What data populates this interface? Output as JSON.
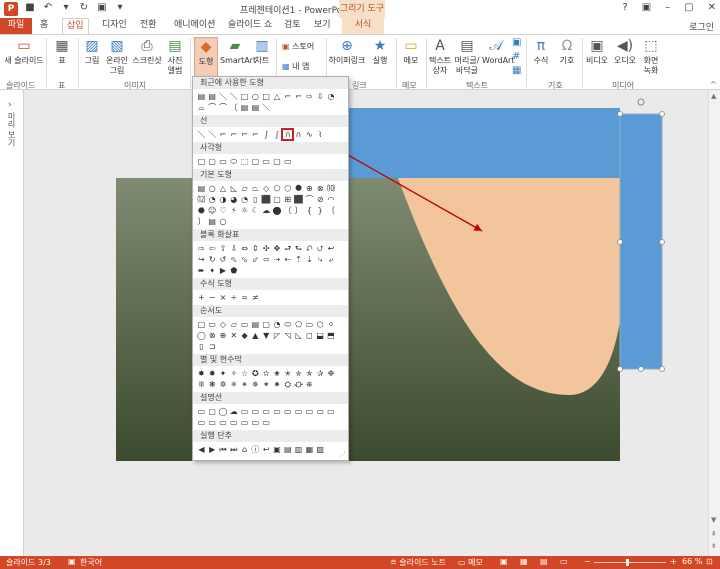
{
  "titlebar": {
    "app_logo": "P",
    "qat_icons": [
      "save-icon",
      "undo-icon",
      "undo-dropdown-icon",
      "redo-icon",
      "present-icon",
      "customize-icon"
    ],
    "qat_glyphs": [
      "■",
      "↶",
      "▾",
      "↻",
      "▣",
      "▾"
    ],
    "doc_title": "프레젠테이션1 - PowerPoint",
    "context_title": "그리기 도구",
    "controls": [
      "?",
      "▣",
      "–",
      "▢",
      "✕"
    ]
  },
  "tabs": {
    "file": "파일",
    "items": [
      "홈",
      "삽입",
      "디자인",
      "전환",
      "애니메이션",
      "슬라이드 쇼",
      "검토",
      "보기"
    ],
    "context_tab": "서식",
    "login": "로그인"
  },
  "ribbon": {
    "new_slide": "새 슬라이드",
    "table": "표",
    "picture": "그림",
    "online_picture": "온라인 그림",
    "screenshot": "스크린샷",
    "photo_album": "사진 앨범",
    "shapes": "도형",
    "smartart": "SmartArt",
    "chart": "차트",
    "store": "스토어",
    "my_apps": "내 앱",
    "hyperlink": "하이퍼링크",
    "action": "실행",
    "comment": "메모",
    "textbox": "텍스트 상자",
    "header_footer": "머리글/바닥글",
    "wordart": "WordArt",
    "equation": "수식",
    "symbol": "기호",
    "video": "비디오",
    "audio": "오디오",
    "screen_recording": "화면 녹화",
    "groups": [
      "슬라이드",
      "표",
      "이미지",
      "링크",
      "메모",
      "텍스트",
      "기호",
      "미디어"
    ]
  },
  "left_panel": {
    "collapse": "›",
    "label": "미리 보기"
  },
  "gallery": {
    "sections": [
      {
        "title": "최근에 사용한 도형",
        "glyphs": "▤▤＼＼□○□△⌐⌐⇨⇩◔⌓⌒⌒〔",
        "count": 20
      },
      {
        "title": "선",
        "glyphs": "＼＼⌐⌐⌐⌐∫∫∩∩∿⌇",
        "count": 12
      },
      {
        "title": "사각형",
        "glyphs": "□▢▭⬭⬚▢▭▢▭",
        "count": 9
      },
      {
        "title": "기본 도형",
        "glyphs": "▤○△◺▱⏢◇⬠⬡⯃⊕⊗⑽⑿◔◑◕◔▯⬛▢⊞⬛⌒⊘◠⬣☺♡⚡☼☾☁⬤〔〕{}〔〕",
        "count": 42
      },
      {
        "title": "블록 화살표",
        "glyphs": "⇨⇦⇧⇩⇔⇕✣✥⮐⮑⮏⮍↩↪↻↺⬁⬂⬃⬄⇢⇠⇡⇣⤷⤶➨➧▶⬟⬢⊲⊳",
        "count": 30
      },
      {
        "title": "수식 도형",
        "glyphs": "+−×÷=≠",
        "count": 6
      },
      {
        "title": "순서도",
        "glyphs": "□▭◇▱▭▤▢◔⬭⬠▭⬡⚪◯⊗⊕✕◆▲▼◸◹◺◻⬓⬒▯⊐",
        "count": 28
      },
      {
        "title": "별 및 현수막",
        "glyphs": "✸✹✦✧☆✪✫✬✭✮✯✰❉❊❋✲✳✴✵✶✷⛭⛮⛯⚝",
        "count": 24
      },
      {
        "title": "설명선",
        "glyphs": "▭▢◯☁▭▭▭▭▭▭▭▭▭▭▭▭▭▭▭▭",
        "count": 20
      },
      {
        "title": "실행 단추",
        "glyphs": "◀▶⏮⏭⌂ⓘ↩▣▤▥▦▧",
        "count": 12
      }
    ],
    "highlight_section": 1,
    "highlight_index": 8
  },
  "slide": {
    "blue_color": "#5b9bd5",
    "peach_color": "#f3c59d",
    "bg_top": "#7f8b72",
    "bg_bottom": "#3c4a2e",
    "arrow_color": "#c00000"
  },
  "statusbar": {
    "slide_info": "슬라이드 3/3",
    "language": "한국어",
    "notes": "슬라이드 노트",
    "comments": "메모",
    "zoom": "66 %"
  }
}
